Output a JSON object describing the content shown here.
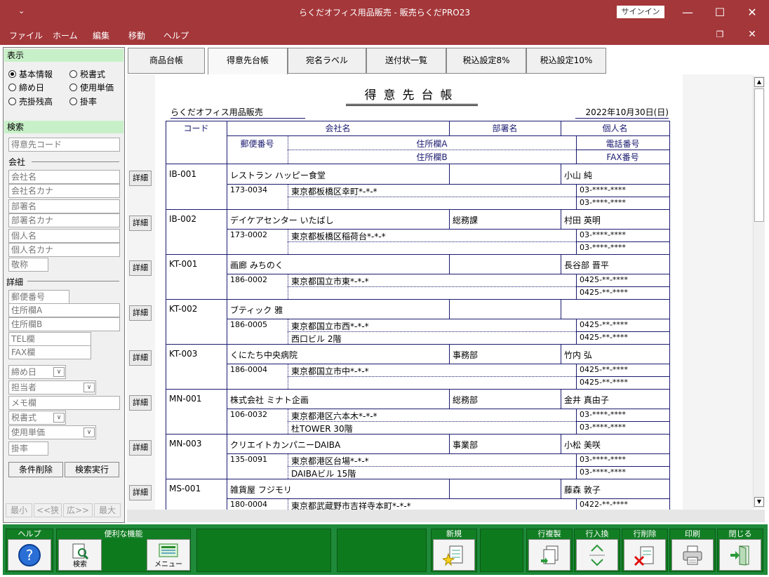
{
  "window": {
    "title": "らくだオフィス用品販売 - 販売らくだPRO23",
    "signin": "サインイン",
    "qat": "⌄"
  },
  "menu": [
    "ファイル",
    "ホーム",
    "編集",
    "移動",
    "ヘルプ"
  ],
  "left": {
    "display_head": "表示",
    "radios": [
      {
        "label": "基本情報",
        "on": true
      },
      {
        "label": "税書式",
        "on": false
      },
      {
        "label": "締め日",
        "on": false
      },
      {
        "label": "使用単価",
        "on": false
      },
      {
        "label": "売掛残高",
        "on": false
      },
      {
        "label": "掛率",
        "on": false
      }
    ],
    "search_head": "検索",
    "code_ph": "得意先コード",
    "company_label": "会社",
    "company_fields": [
      "会社名",
      "会社名カナ",
      "部署名",
      "部署名カナ",
      "個人名",
      "個人名カナ"
    ],
    "honorific_ph": "敬称",
    "detail_label": "詳細",
    "detail_fields": {
      "zip": "郵便番号",
      "addrA": "住所欄A",
      "addrB": "住所欄B",
      "tel": "TEL欄",
      "fax": "FAX欄",
      "closing": "締め日",
      "staff": "担当者",
      "memo": "メモ欄",
      "tax": "税書式",
      "price": "使用単価",
      "rate": "掛率"
    },
    "clear_btn": "条件削除",
    "search_btn": "検索実行",
    "nav": [
      "最小",
      "<<狭",
      "広>>",
      "最大"
    ]
  },
  "tabs": [
    "商品台帳",
    "得意先台帳",
    "宛名ラベル",
    "送付状一覧",
    "税込設定8%",
    "税込設定10%"
  ],
  "sheet": {
    "title": "得意先台帳",
    "company": "らくだオフィス用品販売",
    "date": "2022年10月30日(日)",
    "headers": {
      "code": "コード",
      "company": "会社名",
      "dept": "部署名",
      "person": "個人名",
      "zip": "郵便番号",
      "addrA": "住所欄A",
      "addrB": "住所欄B",
      "tel": "電話番号",
      "fax": "FAX番号"
    },
    "detail_label": "詳細",
    "rows": [
      {
        "code": "IB-001",
        "company": "レストラン ハッピー食堂",
        "dept": "",
        "person": "小山 純",
        "zip": "173-0034",
        "addrA": "東京都板橋区幸町*-*-*",
        "addrB": "",
        "tel": "03-****-****",
        "fax": "03-****-****"
      },
      {
        "code": "IB-002",
        "company": "デイケアセンター いたばし",
        "dept": "総務課",
        "person": "村田 英明",
        "zip": "173-0002",
        "addrA": "東京都板橋区稲荷台*-*-*",
        "addrB": "",
        "tel": "03-****-****",
        "fax": "03-****-****"
      },
      {
        "code": "KT-001",
        "company": "画廊 みちのく",
        "dept": "",
        "person": "長谷部 晋平",
        "zip": "186-0002",
        "addrA": "東京都国立市東*-*-*",
        "addrB": "",
        "tel": "0425-**-****",
        "fax": "0425-**-****"
      },
      {
        "code": "KT-002",
        "company": "ブティック 雅",
        "dept": "",
        "person": "",
        "zip": "186-0005",
        "addrA": "東京都国立市西*-*-*",
        "addrB": "西口ビル 2階",
        "tel": "0425-**-****",
        "fax": "0425-**-****"
      },
      {
        "code": "KT-003",
        "company": "くにたち中央病院",
        "dept": "事務部",
        "person": "竹内 弘",
        "zip": "186-0004",
        "addrA": "東京都国立市中*-*-*",
        "addrB": "",
        "tel": "0425-**-****",
        "fax": "0425-**-****"
      },
      {
        "code": "MN-001",
        "company": "株式会社 ミナト企画",
        "dept": "総務部",
        "person": "金井 真由子",
        "zip": "106-0032",
        "addrA": "東京都港区六本木*-*-*",
        "addrB": "杜TOWER 30階",
        "tel": "03-****-****",
        "fax": "03-****-****"
      },
      {
        "code": "MN-003",
        "company": "クリエイトカンパニーDAIBA",
        "dept": "事業部",
        "person": "小松 美咲",
        "zip": "135-0091",
        "addrA": "東京都港区台場*-*-*",
        "addrB": "DAIBAビル 15階",
        "tel": "03-****-****",
        "fax": "03-****-****"
      },
      {
        "code": "MS-001",
        "company": "雑貨屋 フジモリ",
        "dept": "",
        "person": "藤森 敦子",
        "zip": "180-0004",
        "addrA": "東京都武蔵野市吉祥寺本町*-*-*",
        "addrB": "",
        "tel": "0422-**-****",
        "fax": ""
      }
    ]
  },
  "bottom": {
    "help": "ヘルプ",
    "useful": "便利な機能",
    "search": "検索",
    "menu": "メニュー",
    "new": "新規",
    "rowcopy": "行複製",
    "rowswap": "行入換",
    "rowdel": "行削除",
    "print": "印刷",
    "close": "閉じる"
  }
}
